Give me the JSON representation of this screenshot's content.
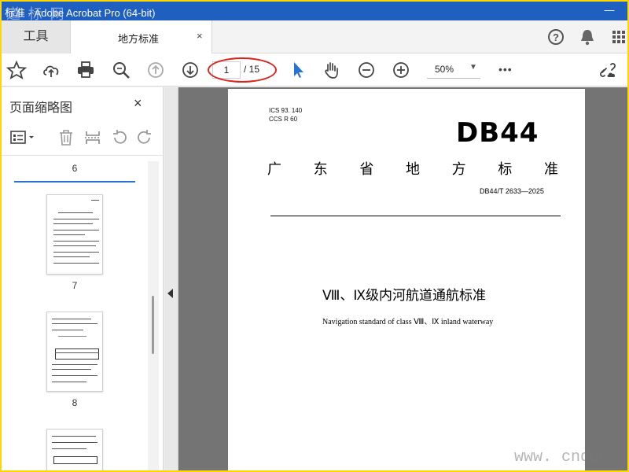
{
  "window": {
    "title": "标准 - Adobe Acrobat Pro (64-bit)",
    "minimize": "—"
  },
  "watermarks": {
    "top_left": "道 标 网",
    "bottom_right": "www. cndac"
  },
  "tabs": {
    "tools_label": "工具",
    "doc_label": "地方标准",
    "doc_close": "×"
  },
  "tab_icons": [
    "help-icon",
    "bell-icon",
    "apps-grid-icon"
  ],
  "toolbar": {
    "icons": [
      "star-icon",
      "upload-icon",
      "print-icon",
      "search-zoom-icon",
      "prev-page-icon",
      "next-page-icon",
      "select-arrow-icon",
      "hand-icon",
      "zoom-out-icon",
      "zoom-in-icon",
      "more-icon",
      "link-cloud-icon"
    ],
    "page_current": "1",
    "page_total": "/ 15",
    "zoom_value": "50%",
    "more": "•••"
  },
  "sidepanel": {
    "title": "页面缩略图",
    "close": "×",
    "current_label": "6",
    "thumbnails": [
      {
        "label": "7"
      },
      {
        "label": "8"
      }
    ]
  },
  "document": {
    "ics": "ICS  93. 140",
    "ccs": "CCS  R  60",
    "code": "DB44",
    "std_name_chars": [
      "广",
      "东",
      "省",
      "地",
      "方",
      "标",
      "准"
    ],
    "std_no": "DB44/T  2633—2025",
    "cn_title": "Ⅷ、Ⅸ级内河航道通航标准",
    "en_title": "Navigation standard of class  Ⅷ、Ⅸ  inland waterway"
  },
  "colors": {
    "titlebar": "#1f5fbf",
    "highlight_ellipse": "#d9241f",
    "accent_blue": "#2a74d0",
    "frame_border": "#ffd700"
  }
}
